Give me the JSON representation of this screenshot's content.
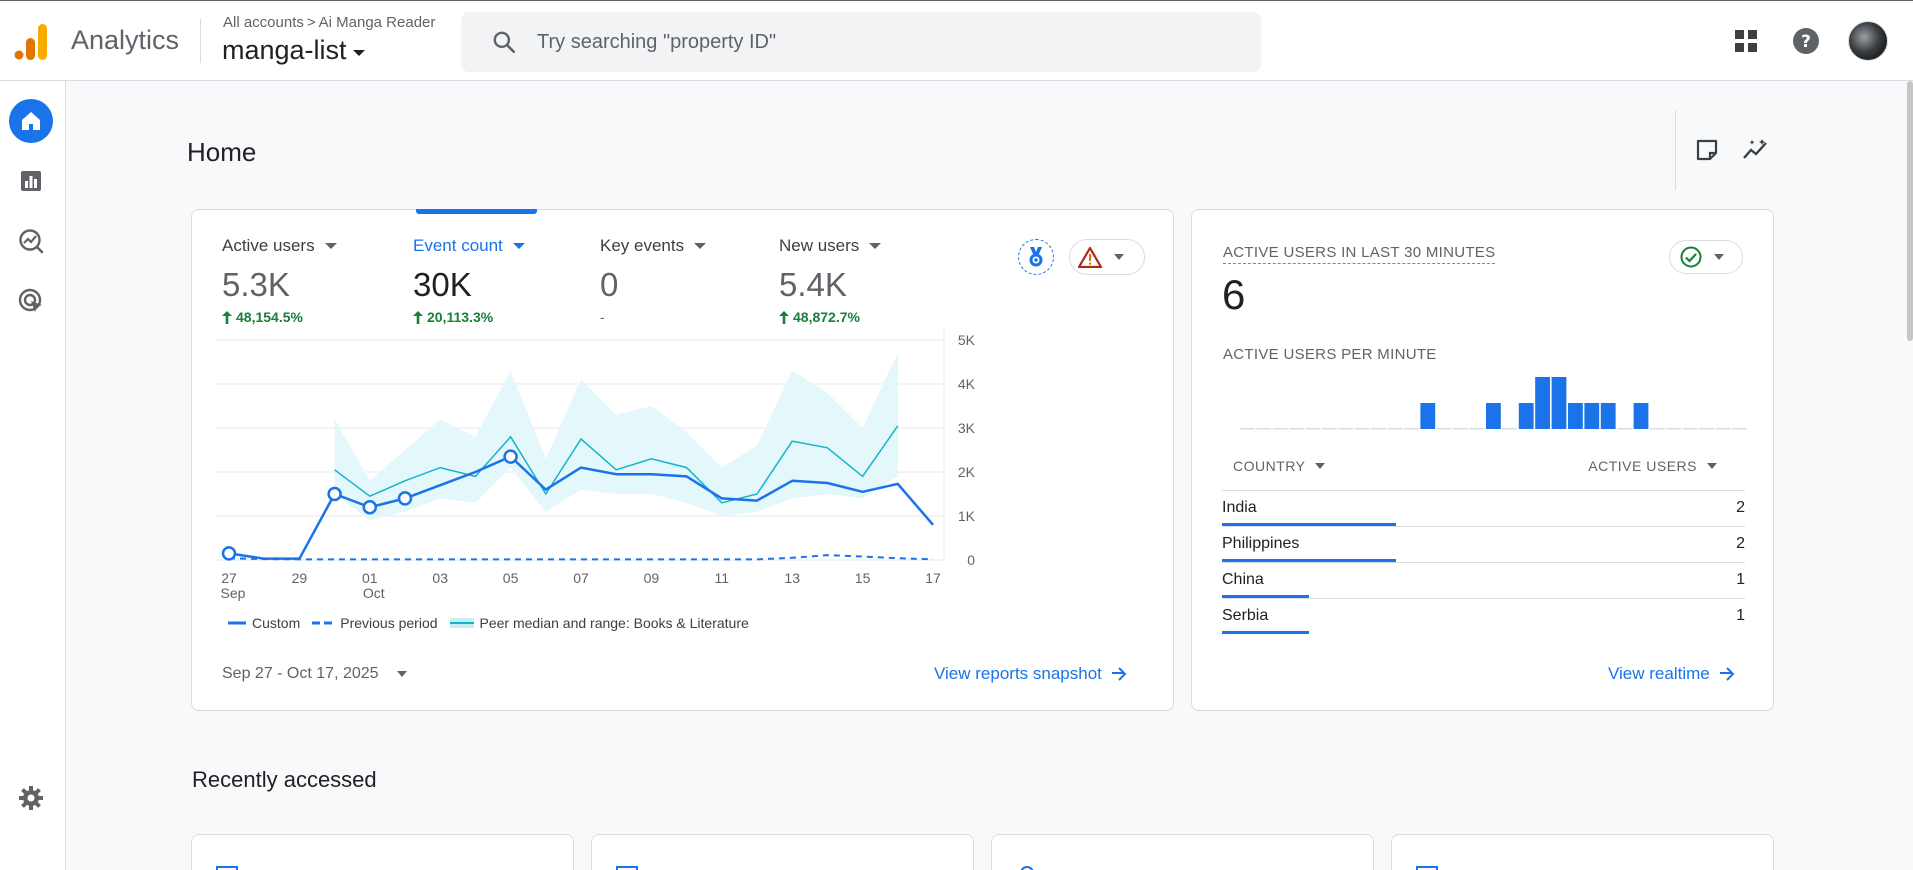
{
  "app": {
    "product": "Analytics",
    "breadcrumb": {
      "root": "All accounts",
      "separator": ">",
      "account": "Ai Manga Reader"
    },
    "property": "manga-list",
    "search_placeholder": "Try searching \"property ID\""
  },
  "topbar_icons": [
    "apps-grid-icon",
    "help-icon",
    "avatar"
  ],
  "nav": [
    {
      "name": "home",
      "icon": "home-icon",
      "active": true
    },
    {
      "name": "reports",
      "icon": "reports-icon",
      "active": false
    },
    {
      "name": "explore",
      "icon": "explore-icon",
      "active": false
    },
    {
      "name": "advertising",
      "icon": "advertising-icon",
      "active": false
    },
    {
      "name": "admin",
      "icon": "gear-icon",
      "active": false
    }
  ],
  "page": {
    "title": "Home"
  },
  "overview": {
    "metrics": [
      {
        "label": "Active users",
        "value": "5.3K",
        "change": "48,154.5%",
        "trend": "up",
        "selected": false
      },
      {
        "label": "Event count",
        "value": "30K",
        "change": "20,113.3%",
        "trend": "up",
        "selected": true
      },
      {
        "label": "Key events",
        "value": "0",
        "change": "-",
        "trend": "none",
        "selected": false
      },
      {
        "label": "New users",
        "value": "5.4K",
        "change": "48,872.7%",
        "trend": "up",
        "selected": false
      }
    ],
    "date_range": "Sep 27 - Oct 17, 2025",
    "link": "View reports snapshot",
    "legend": {
      "custom": "Custom",
      "previous": "Previous period",
      "peer": "Peer median and range: Books & Literature"
    },
    "colors": {
      "custom": "#1a73e8",
      "peer_line": "#12b5cb",
      "peer_band": "#e4f7fa",
      "previous": "#1a73e8"
    }
  },
  "chart_data": {
    "type": "line",
    "x": [
      "Sep 27",
      "Sep 28",
      "Sep 29",
      "Sep 30",
      "Oct 01",
      "Oct 02",
      "Oct 03",
      "Oct 04",
      "Oct 05",
      "Oct 06",
      "Oct 07",
      "Oct 08",
      "Oct 09",
      "Oct 10",
      "Oct 11",
      "Oct 12",
      "Oct 13",
      "Oct 14",
      "Oct 15",
      "Oct 16",
      "Oct 17"
    ],
    "x_tick_labels": [
      {
        "label": "27",
        "sub": "Sep",
        "index": 0
      },
      {
        "label": "29",
        "sub": "",
        "index": 2
      },
      {
        "label": "01",
        "sub": "Oct",
        "index": 4
      },
      {
        "label": "03",
        "sub": "",
        "index": 6
      },
      {
        "label": "05",
        "sub": "",
        "index": 8
      },
      {
        "label": "07",
        "sub": "",
        "index": 10
      },
      {
        "label": "09",
        "sub": "",
        "index": 12
      },
      {
        "label": "11",
        "sub": "",
        "index": 14
      },
      {
        "label": "13",
        "sub": "",
        "index": 16
      },
      {
        "label": "15",
        "sub": "",
        "index": 18
      },
      {
        "label": "17",
        "sub": "",
        "index": 20
      }
    ],
    "y_ticks": [
      "0",
      "1K",
      "2K",
      "3K",
      "4K",
      "5K"
    ],
    "ylim": [
      0,
      5000
    ],
    "series": [
      {
        "name": "Custom",
        "style": "solid",
        "markers": [
          0,
          3,
          4,
          5,
          8
        ],
        "values": [
          150,
          30,
          30,
          1500,
          1200,
          1400,
          1700,
          2000,
          2350,
          1600,
          2100,
          1950,
          1950,
          1900,
          1400,
          1350,
          1800,
          1750,
          1550,
          1730,
          800
        ]
      },
      {
        "name": "Previous period",
        "style": "dashed",
        "values": [
          40,
          20,
          15,
          15,
          15,
          15,
          15,
          15,
          15,
          15,
          15,
          15,
          15,
          15,
          15,
          15,
          50,
          110,
          80,
          40,
          15
        ]
      },
      {
        "name": "Peer median and range: Books & Literature",
        "style": "band",
        "values": [
          null,
          null,
          null,
          2050,
          1450,
          1800,
          2100,
          1900,
          2800,
          1500,
          2750,
          2050,
          2300,
          2100,
          1300,
          1500,
          2700,
          2550,
          1900,
          3050,
          null
        ],
        "low": [
          null,
          null,
          null,
          1500,
          900,
          1100,
          1400,
          1300,
          2100,
          1100,
          1600,
          1500,
          1500,
          1300,
          1000,
          1100,
          1400,
          1500,
          1400,
          1900,
          null
        ],
        "high": [
          null,
          null,
          null,
          3200,
          1800,
          2500,
          3200,
          2800,
          4300,
          2300,
          4100,
          3300,
          3500,
          2900,
          2100,
          2600,
          4300,
          3800,
          3000,
          4700,
          null
        ]
      }
    ]
  },
  "realtime": {
    "title": "ACTIVE USERS IN LAST 30 MINUTES",
    "value": "6",
    "per_minute_label": "ACTIVE USERS PER MINUTE",
    "per_minute": [
      0,
      0,
      0,
      0,
      0,
      0,
      0,
      0,
      0,
      0,
      0,
      1,
      0,
      0,
      0,
      1,
      0,
      1,
      2,
      2,
      1,
      1,
      1,
      0,
      1,
      0,
      0,
      0,
      0,
      0,
      0
    ],
    "col_country": "COUNTRY",
    "col_users": "ACTIVE USERS",
    "rows": [
      {
        "country": "India",
        "users": "2",
        "share": 1.0
      },
      {
        "country": "Philippines",
        "users": "2",
        "share": 1.0
      },
      {
        "country": "China",
        "users": "1",
        "share": 0.5
      },
      {
        "country": "Serbia",
        "users": "1",
        "share": 0.5
      }
    ],
    "link": "View realtime"
  },
  "recent": {
    "title": "Recently accessed"
  }
}
